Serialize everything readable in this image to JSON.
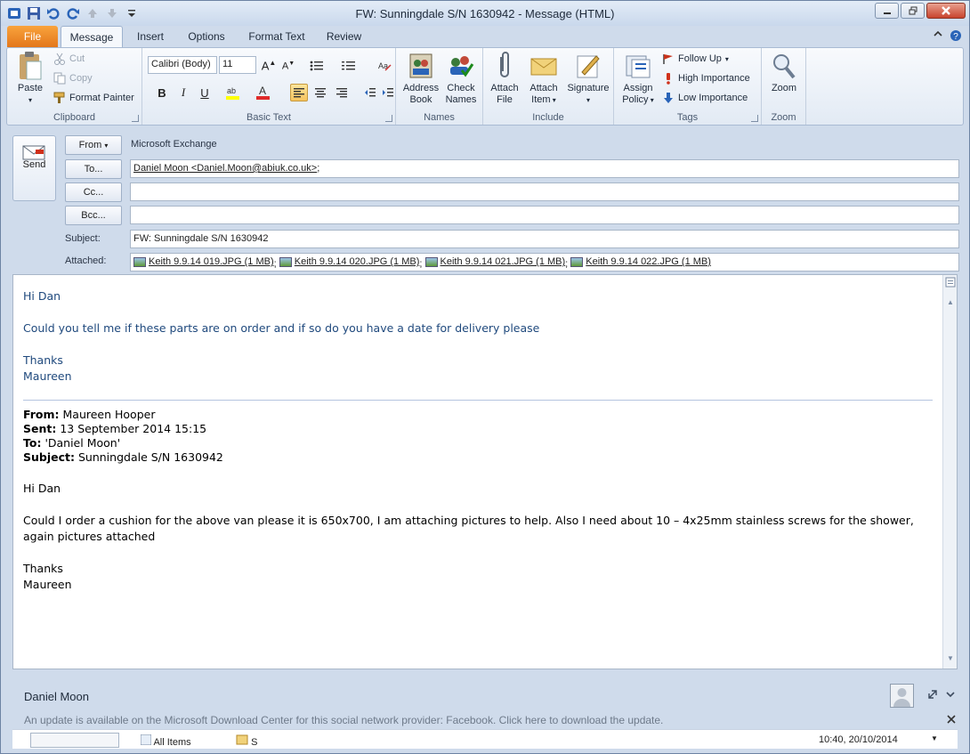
{
  "window": {
    "title": "FW: Sunningdale  S/N  1630942  -  Message (HTML)"
  },
  "ribbon_tabs": [
    "File",
    "Message",
    "Insert",
    "Options",
    "Format Text",
    "Review"
  ],
  "clipboard": {
    "paste": "Paste",
    "cut": "Cut",
    "copy": "Copy",
    "format_painter": "Format Painter",
    "group_label": "Clipboard"
  },
  "basic_text": {
    "font": "Calibri (Body)",
    "size": "11",
    "bold": "B",
    "italic": "I",
    "underline": "U",
    "group_label": "Basic Text"
  },
  "names": {
    "address_book_line1": "Address",
    "address_book_line2": "Book",
    "check_names_line1": "Check",
    "check_names_line2": "Names",
    "group_label": "Names"
  },
  "include": {
    "attach_file_line1": "Attach",
    "attach_file_line2": "File",
    "attach_item_line1": "Attach",
    "attach_item_line2": "Item",
    "signature": "Signature",
    "group_label": "Include"
  },
  "tags": {
    "assign_policy_line1": "Assign",
    "assign_policy_line2": "Policy",
    "follow_up": "Follow Up",
    "high_importance": "High Importance",
    "low_importance": "Low Importance",
    "group_label": "Tags"
  },
  "zoom": {
    "zoom_button": "Zoom",
    "group_label": "Zoom"
  },
  "header": {
    "send": "Send",
    "from_button": "From",
    "from_value": "Microsoft Exchange",
    "to_button": "To...",
    "to_value": "Daniel Moon <Daniel.Moon@abiuk.co.uk>",
    "to_suffix": ";",
    "cc_button": "Cc...",
    "cc_value": "",
    "bcc_button": "Bcc...",
    "bcc_value": "",
    "subject_label": "Subject:",
    "subject_value": "FW: Sunningdale  S/N  1630942",
    "attached_label": "Attached:",
    "attachments": [
      "Keith 9.9.14 019.JPG (1 MB)",
      "Keith 9.9.14 020.JPG (1 MB)",
      "Keith 9.9.14 021.JPG (1 MB)",
      "Keith 9.9.14 022.JPG (1 MB)"
    ]
  },
  "body": {
    "greeting": "Hi Dan",
    "question": "Could you tell me if these parts are on order and if so do you have a date for delivery please",
    "thanks": "Thanks",
    "signoff": "Maureen",
    "fwd_from_label": "From:",
    "fwd_from_value": "Maureen Hooper",
    "fwd_sent_label": "Sent:",
    "fwd_sent_value": "13 September 2014 15:15",
    "fwd_to_label": "To:",
    "fwd_to_value": "'Daniel Moon'",
    "fwd_subject_label": "Subject:",
    "fwd_subject_value": "Sunningdale S/N 1630942",
    "fwd_greeting": "Hi Dan",
    "fwd_message": "Could I order a cushion for the above van please it is 650x700, I am attaching pictures to help.  Also I need about 10 – 4x25mm stainless screws for the shower, again pictures attached",
    "fwd_thanks": "Thanks",
    "fwd_signoff": "Maureen"
  },
  "people_pane": {
    "name": "Daniel Moon",
    "update_message": "An update is available on the Microsoft Download Center for this social network provider: Facebook. Click here to download the update.",
    "feed_all_items": "All Items",
    "feed_entry_initial": "S",
    "feed_timestamp": "10:40, 20/10/2014"
  },
  "colors": {
    "file_tab": "#e3771b",
    "body_blue_text": "#1f497d",
    "accent_pressed": "#f6c35e"
  }
}
